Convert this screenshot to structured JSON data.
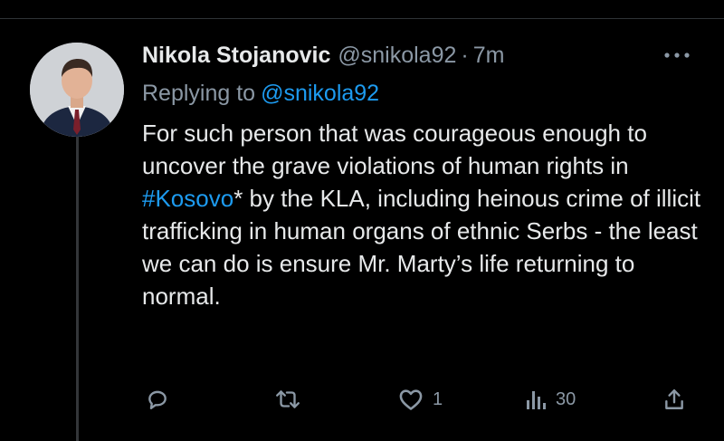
{
  "tweet": {
    "display_name": "Nikola Stojanovic",
    "handle": "@snikola92",
    "separator": "·",
    "time": "7m",
    "replying_prefix": "Replying to",
    "replying_handle": "@snikola92",
    "text_before_hashtag": "For such person that was courageous enough to uncover the grave violations of human rights in ",
    "hashtag": "#Kosovo",
    "text_after_hashtag": "* by the KLA, including heinous crime of illicit trafficking in human organs of ethnic Serbs - the least we can do is ensure Mr. Marty’s life returning to normal."
  },
  "actions": {
    "reply_icon": "reply-icon",
    "retweet_icon": "retweet-icon",
    "like_icon": "heart-icon",
    "like_count": "1",
    "views_icon": "views-icon",
    "views_count": "30",
    "share_icon": "share-icon"
  },
  "colors": {
    "background": "#000000",
    "text_primary": "#e7e9ea",
    "text_secondary": "#8b98a5",
    "link_blue": "#1d9bf0"
  }
}
